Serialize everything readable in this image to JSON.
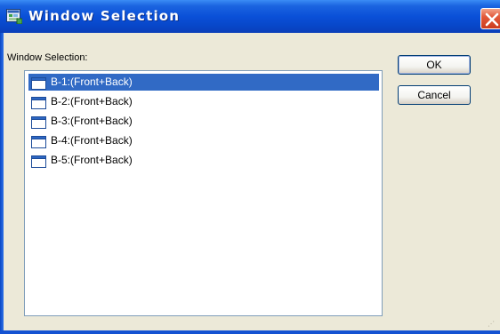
{
  "window": {
    "title": "Window Selection"
  },
  "dialog": {
    "list_label": "Window Selection:",
    "items": [
      {
        "label": "B-1:(Front+Back)",
        "selected": true
      },
      {
        "label": "B-2:(Front+Back)",
        "selected": false
      },
      {
        "label": "B-3:(Front+Back)",
        "selected": false
      },
      {
        "label": "B-4:(Front+Back)",
        "selected": false
      },
      {
        "label": "B-5:(Front+Back)",
        "selected": false
      }
    ],
    "ok_label": "OK",
    "cancel_label": "Cancel"
  },
  "icons": {
    "title": "window-selection-app-icon",
    "close": "close-icon",
    "item": "window-icon",
    "grip": "resize-grip-icon"
  },
  "colors": {
    "titlebar": "#0a50d8",
    "selection": "#316ac5",
    "close": "#e2593a",
    "face": "#ece9d8"
  }
}
